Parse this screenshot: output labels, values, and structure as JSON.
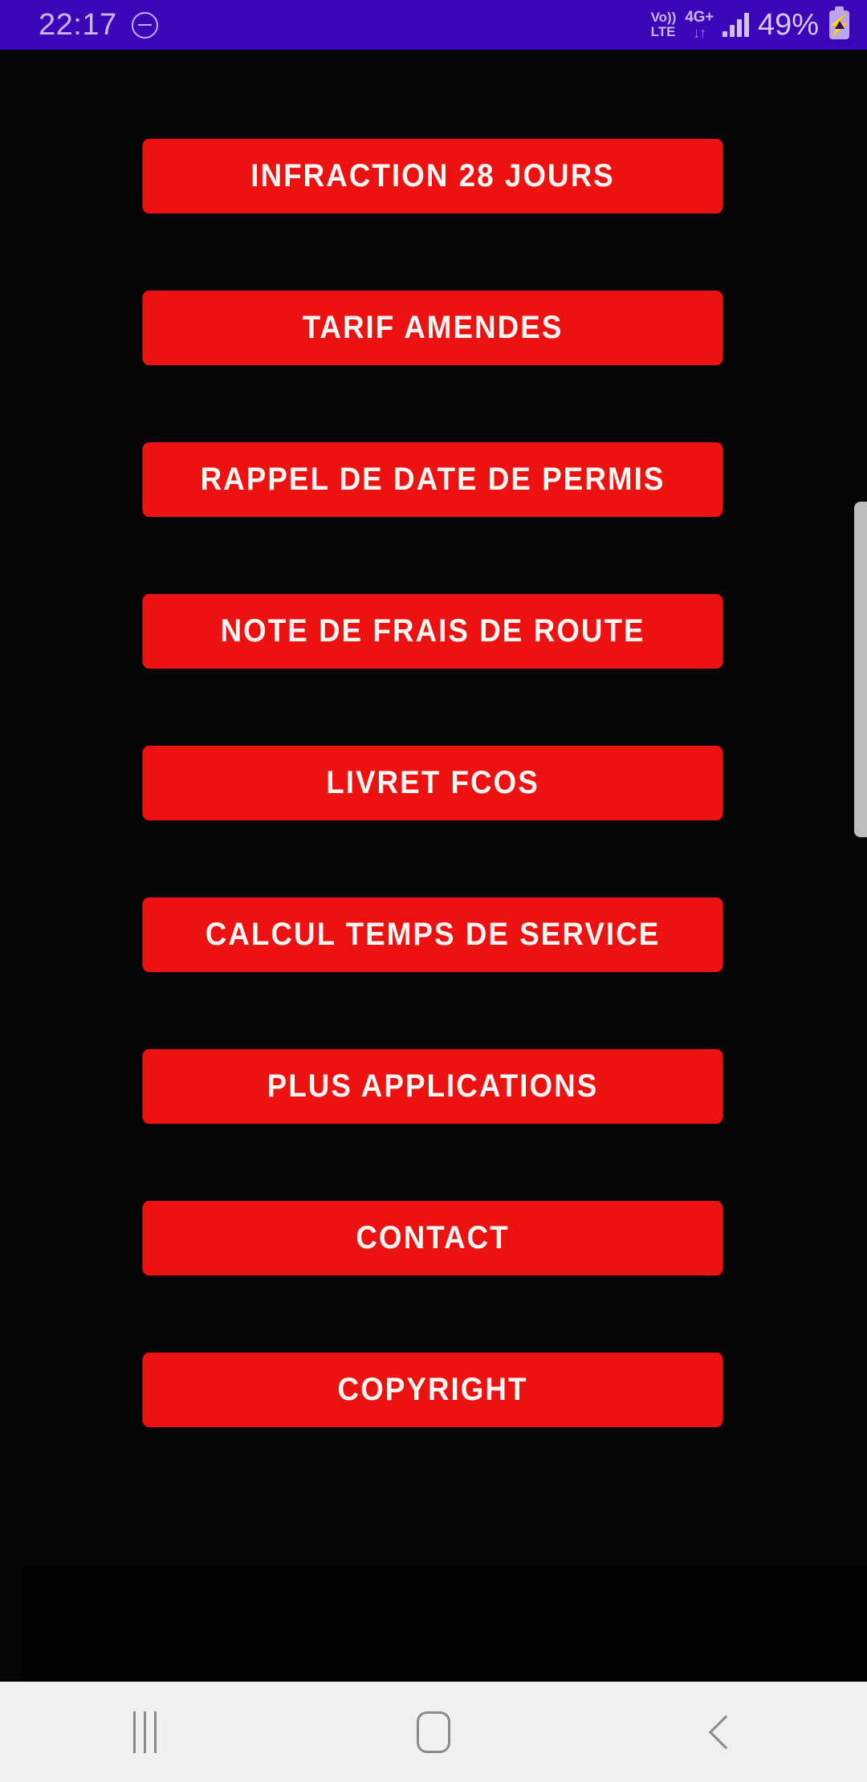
{
  "status_bar": {
    "time": "22:17",
    "dnd_icon": "do-not-disturb-icon",
    "volte_label": "Vo))\nLTE",
    "volte_line1": "Vo))",
    "volte_line2": "LTE",
    "network_type": "4G+",
    "network_arrows": "↓↑",
    "signal_icon": "signal-bars-icon",
    "battery_percent": "49%",
    "battery_icon": "battery-charging-icon",
    "background_color": "#3A06B8",
    "text_color": "#CBB6F0"
  },
  "main": {
    "background_color": "#050505",
    "button_color": "#ED1212",
    "button_text_color": "#FBF6F2",
    "buttons": [
      {
        "label": "INFRACTION 28 JOURS"
      },
      {
        "label": "TARIF AMENDES"
      },
      {
        "label": "RAPPEL DE DATE DE PERMIS"
      },
      {
        "label": "NOTE DE FRAIS DE ROUTE"
      },
      {
        "label": "LIVRET FCOS"
      },
      {
        "label": "CALCUL TEMPS DE SERVICE"
      },
      {
        "label": "PLUS APPLICATIONS"
      },
      {
        "label": "CONTACT"
      },
      {
        "label": "COPYRIGHT"
      }
    ]
  },
  "scrollbar": {
    "color": "#BDBDBD"
  },
  "ad_banner": {
    "color": "#000000"
  },
  "nav_bar": {
    "background_color": "#F0F0F0",
    "icon_color": "#8A8A8A",
    "recents_icon": "recents-icon",
    "home_icon": "home-icon",
    "back_icon": "back-icon"
  }
}
